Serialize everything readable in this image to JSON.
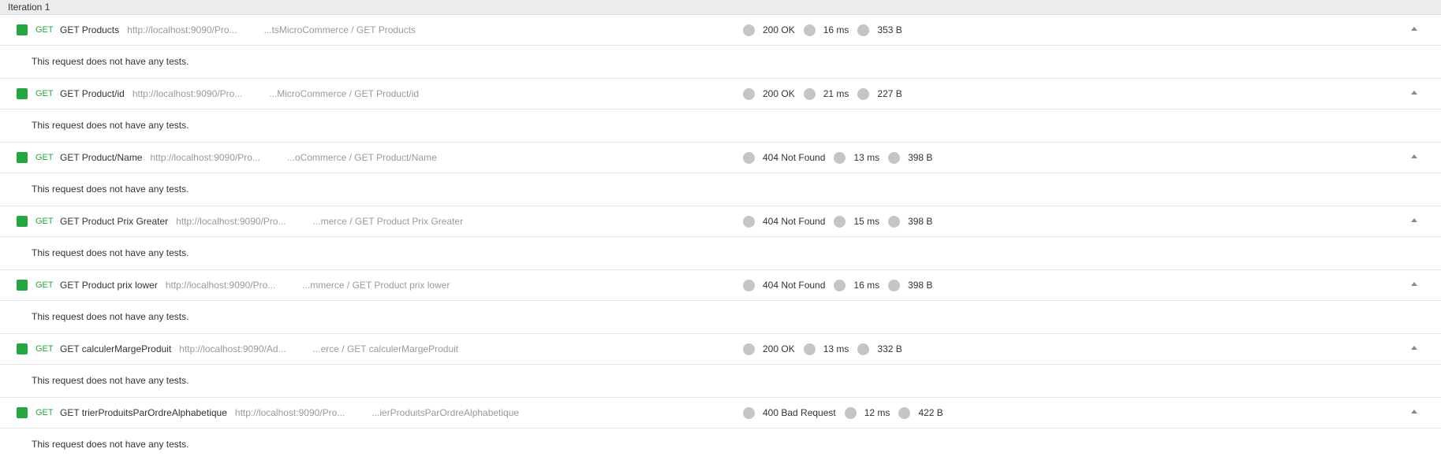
{
  "iteration": {
    "label": "Iteration 1"
  },
  "tests_message": "This request does not have any tests.",
  "colors": {
    "pass": "#26a641",
    "neutral_dot": "#c5c5c5",
    "header_bg": "#ececec"
  },
  "requests": [
    {
      "method": "GET",
      "name": "GET Products",
      "url": "http://localhost:9090/Pro...",
      "path": "...tsMicroCommerce / GET Products",
      "status": "200 OK",
      "time": "16 ms",
      "size": "353 B"
    },
    {
      "method": "GET",
      "name": "GET Product/id",
      "url": "http://localhost:9090/Pro...",
      "path": "...MicroCommerce / GET Product/id",
      "status": "200 OK",
      "time": "21 ms",
      "size": "227 B"
    },
    {
      "method": "GET",
      "name": "GET Product/Name",
      "url": "http://localhost:9090/Pro...",
      "path": "...oCommerce / GET Product/Name",
      "status": "404 Not Found",
      "time": "13 ms",
      "size": "398 B"
    },
    {
      "method": "GET",
      "name": "GET Product Prix Greater",
      "url": "http://localhost:9090/Pro...",
      "path": "...merce / GET Product Prix Greater",
      "status": "404 Not Found",
      "time": "15 ms",
      "size": "398 B"
    },
    {
      "method": "GET",
      "name": "GET Product prix lower",
      "url": "http://localhost:9090/Pro...",
      "path": "...mmerce / GET Product prix lower",
      "status": "404 Not Found",
      "time": "16 ms",
      "size": "398 B"
    },
    {
      "method": "GET",
      "name": "GET calculerMargeProduit",
      "url": "http://localhost:9090/Ad...",
      "path": "...erce / GET calculerMargeProduit",
      "status": "200 OK",
      "time": "13 ms",
      "size": "332 B"
    },
    {
      "method": "GET",
      "name": "GET trierProduitsParOrdreAlphabetique",
      "url": "http://localhost:9090/Pro...",
      "path": "...ierProduitsParOrdreAlphabetique",
      "status": "400 Bad Request",
      "time": "12 ms",
      "size": "422 B"
    }
  ]
}
